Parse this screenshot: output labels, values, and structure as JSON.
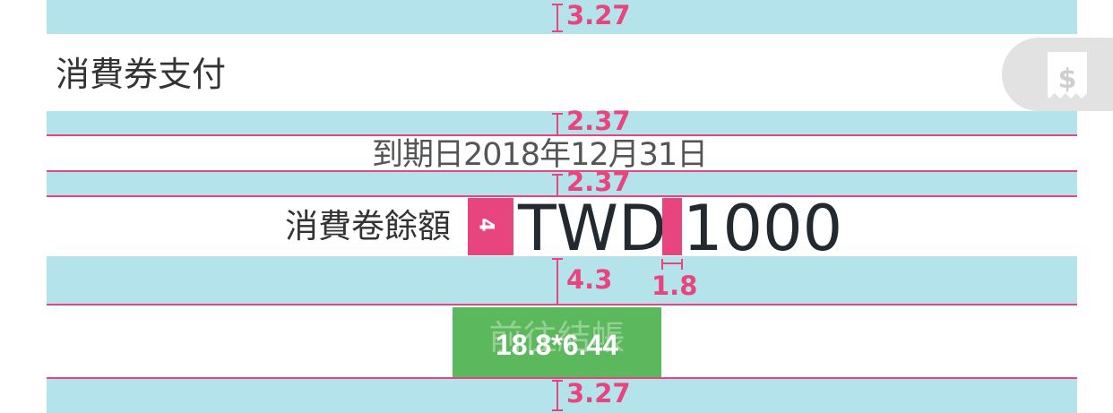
{
  "header": {
    "title": "消費券支付"
  },
  "voucher": {
    "expiry": "到期日2018年12月31日",
    "balance_label": "消費卷餘額",
    "currency": "TWD",
    "amount": "1000"
  },
  "checkout": {
    "label": "前往結帳",
    "size_annotation": "18.8*6.44"
  },
  "floating_button": {
    "icon": "receipt-dollar-icon"
  },
  "dimensions": {
    "top_spacing": "3.27",
    "title_bottom_spacing": "2.37",
    "expiry_bottom_spacing": "2.37",
    "marker": "4",
    "amount_bottom_spacing": "4.3",
    "gap": "1.8",
    "bottom_spacing": "3.27"
  },
  "colors": {
    "guide_band": "#b5e3ec",
    "guide_line": "#e8457f",
    "button": "#5cb85c",
    "fab": "#e2e2e2"
  }
}
